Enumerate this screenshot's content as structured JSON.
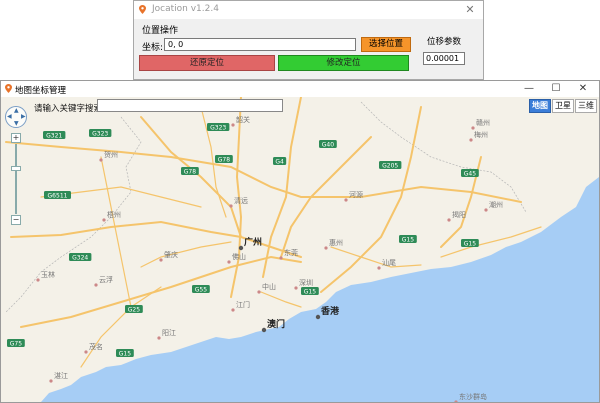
{
  "jocation": {
    "title": "Jocation v1.2.4",
    "close": "✕",
    "group_title": "位置操作",
    "coord_label": "坐标:",
    "coord_value": "0, 0",
    "pick_button": "选择位置",
    "restore_button": "还原定位",
    "modify_button": "修改定位",
    "offset_label": "位移参数",
    "offset_value": "0.00001"
  },
  "mapwin": {
    "title": "地图坐标管理",
    "min": "—",
    "max": "☐",
    "close": "✕",
    "search_label": "请输入关键字搜索",
    "search_value": "",
    "map_types": [
      "地图",
      "卫星",
      "三维"
    ],
    "active_map_type": "地图",
    "zoom_in": "+",
    "zoom_out": "−"
  },
  "map": {
    "land_color": "#f4f1e8",
    "sea_color": "#a6cdf5",
    "road_color": "#f5c46b",
    "cities": [
      {
        "name": "广州",
        "major": true
      },
      {
        "name": "香港",
        "major": true
      },
      {
        "name": "澳门",
        "major": true
      },
      {
        "name": "深圳",
        "major": false
      },
      {
        "name": "东莞",
        "major": false
      },
      {
        "name": "惠州",
        "major": false
      },
      {
        "name": "中山",
        "major": false
      },
      {
        "name": "江门",
        "major": false
      },
      {
        "name": "佛山",
        "major": false
      },
      {
        "name": "清远",
        "major": false
      },
      {
        "name": "河源",
        "major": false
      },
      {
        "name": "汕尾",
        "major": false
      },
      {
        "name": "揭阳",
        "major": false
      },
      {
        "name": "潮州",
        "major": false
      },
      {
        "name": "梅州",
        "major": false
      },
      {
        "name": "韶关",
        "major": false
      },
      {
        "name": "肇庆",
        "major": false
      },
      {
        "name": "云浮",
        "major": false
      },
      {
        "name": "阳江",
        "major": false
      },
      {
        "name": "茂名",
        "major": false
      },
      {
        "name": "湛江",
        "major": false
      },
      {
        "name": "贺州",
        "major": false
      },
      {
        "name": "梧州",
        "major": false
      },
      {
        "name": "玉林",
        "major": false
      },
      {
        "name": "赣州",
        "major": false
      },
      {
        "name": "东沙群岛",
        "major": false
      }
    ],
    "roads": [
      "G321",
      "G323",
      "G323",
      "G45",
      "G4",
      "G78",
      "G78",
      "G205",
      "G15",
      "G15",
      "G15",
      "G15",
      "G6511",
      "G324",
      "G55",
      "G25",
      "G75",
      "G40"
    ]
  }
}
